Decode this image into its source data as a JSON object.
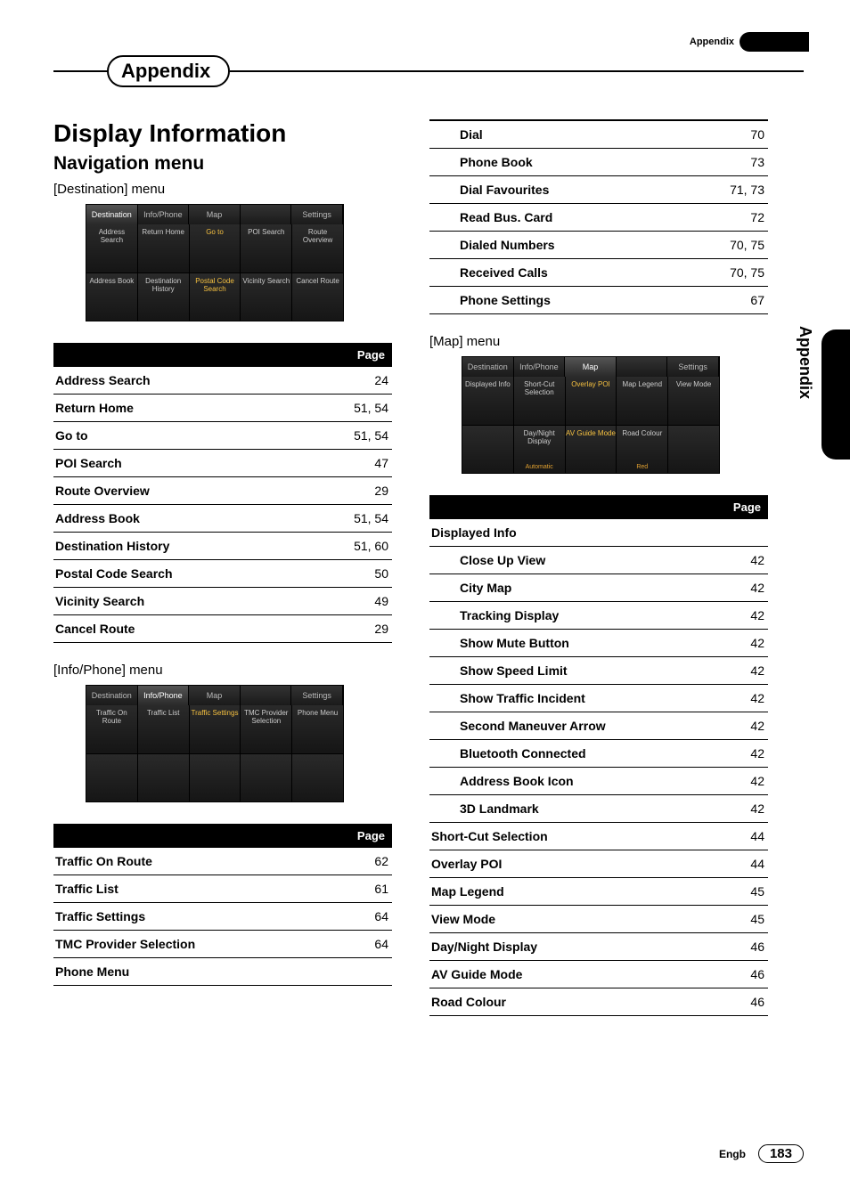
{
  "header": {
    "appendix_label": "Appendix"
  },
  "section_tab": "Appendix",
  "side_tab": "Appendix",
  "title": "Display Information",
  "nav_heading": "Navigation menu",
  "menus": {
    "destination": {
      "heading_prefix": "[",
      "heading_name": "Destination",
      "heading_suffix": "] menu",
      "device_tabs": [
        "Destination",
        "Info/Phone",
        "Map",
        "",
        "Settings"
      ],
      "device_active_tab": 0,
      "device_cells": [
        {
          "t": "Address\nSearch"
        },
        {
          "t": "Return\nHome"
        },
        {
          "t": "Go to",
          "hl": true
        },
        {
          "t": "POI\nSearch"
        },
        {
          "t": "Route\nOverview"
        },
        {
          "t": "Address\nBook"
        },
        {
          "t": "Destination\nHistory"
        },
        {
          "t": "Postal Code\nSearch",
          "hl": true
        },
        {
          "t": "Vicinity\nSearch"
        },
        {
          "t": "Cancel\nRoute"
        }
      ],
      "page_header": "Page",
      "rows": [
        {
          "label": "Address Search",
          "page": "24"
        },
        {
          "label": "Return Home",
          "page": "51, 54"
        },
        {
          "label": "Go to",
          "page": "51, 54"
        },
        {
          "label": "POI Search",
          "page": "47"
        },
        {
          "label": "Route Overview",
          "page": "29"
        },
        {
          "label": "Address Book",
          "page": "51, 54"
        },
        {
          "label": "Destination History",
          "page": "51, 60"
        },
        {
          "label": "Postal Code Search",
          "page": "50"
        },
        {
          "label": "Vicinity Search",
          "page": "49"
        },
        {
          "label": "Cancel Route",
          "page": "29"
        }
      ]
    },
    "infophone": {
      "heading_prefix": "[",
      "heading_name": "Info/Phone",
      "heading_suffix": "] menu",
      "device_tabs": [
        "Destination",
        "Info/Phone",
        "Map",
        "",
        "Settings"
      ],
      "device_active_tab": 1,
      "device_cells": [
        {
          "t": "Traffic On\nRoute"
        },
        {
          "t": "Traffic List"
        },
        {
          "t": "Traffic\nSettings",
          "hl": true
        },
        {
          "t": "TMC\nProvider\nSelection"
        },
        {
          "t": "Phone Menu"
        }
      ],
      "page_header": "Page",
      "rows": [
        {
          "label": "Traffic On Route",
          "page": "62"
        },
        {
          "label": "Traffic List",
          "page": "61"
        },
        {
          "label": "Traffic Settings",
          "page": "64"
        },
        {
          "label": "TMC Provider Selection",
          "page": "64"
        },
        {
          "label": "Phone Menu",
          "page": ""
        }
      ]
    },
    "phone_sub": {
      "rows": [
        {
          "label": "Dial",
          "page": "70"
        },
        {
          "label": "Phone Book",
          "page": "73"
        },
        {
          "label": "Dial Favourites",
          "page": "71, 73"
        },
        {
          "label": "Read Bus. Card",
          "page": "72"
        },
        {
          "label": "Dialed Numbers",
          "page": "70, 75"
        },
        {
          "label": "Received Calls",
          "page": "70, 75"
        },
        {
          "label": "Phone Settings",
          "page": "67"
        }
      ]
    },
    "map": {
      "heading_prefix": "[",
      "heading_name": "Map",
      "heading_suffix": "] menu",
      "device_tabs": [
        "Destination",
        "Info/Phone",
        "Map",
        "",
        "Settings"
      ],
      "device_active_tab": 2,
      "device_cells": [
        {
          "t": "Displayed\nInfo"
        },
        {
          "t": "Short-Cut\nSelection"
        },
        {
          "t": "Overlay\nPOI",
          "hl": true
        },
        {
          "t": "Map Legend"
        },
        {
          "t": "View Mode"
        },
        {
          "t": "",
          "sub": ""
        },
        {
          "t": "Day/Night\nDisplay",
          "sub": "Automatic"
        },
        {
          "t": "AV Guide\nMode",
          "hl": true
        },
        {
          "t": "Road Colour",
          "sub": "Red"
        },
        {
          "t": ""
        }
      ],
      "page_header": "Page",
      "rows": [
        {
          "label": "Displayed Info",
          "page": "",
          "sub": false
        },
        {
          "label": "Close Up View",
          "page": "42",
          "sub": true
        },
        {
          "label": "City Map",
          "page": "42",
          "sub": true
        },
        {
          "label": "Tracking Display",
          "page": "42",
          "sub": true
        },
        {
          "label": "Show Mute Button",
          "page": "42",
          "sub": true
        },
        {
          "label": "Show Speed Limit",
          "page": "42",
          "sub": true
        },
        {
          "label": "Show Traffic Incident",
          "page": "42",
          "sub": true
        },
        {
          "label": "Second Maneuver Arrow",
          "page": "42",
          "sub": true
        },
        {
          "label": "Bluetooth Connected",
          "page": "42",
          "sub": true
        },
        {
          "label": "Address Book Icon",
          "page": "42",
          "sub": true
        },
        {
          "label": "3D Landmark",
          "page": "42",
          "sub": true
        },
        {
          "label": "Short-Cut Selection",
          "page": "44",
          "sub": false
        },
        {
          "label": "Overlay POI",
          "page": "44",
          "sub": false
        },
        {
          "label": "Map Legend",
          "page": "45",
          "sub": false
        },
        {
          "label": "View Mode",
          "page": "45",
          "sub": false
        },
        {
          "label": "Day/Night Display",
          "page": "46",
          "sub": false
        },
        {
          "label": "AV Guide Mode",
          "page": "46",
          "sub": false
        },
        {
          "label": "Road Colour",
          "page": "46",
          "sub": false
        }
      ]
    }
  },
  "footer": {
    "lang": "Engb",
    "page_no": "183"
  }
}
